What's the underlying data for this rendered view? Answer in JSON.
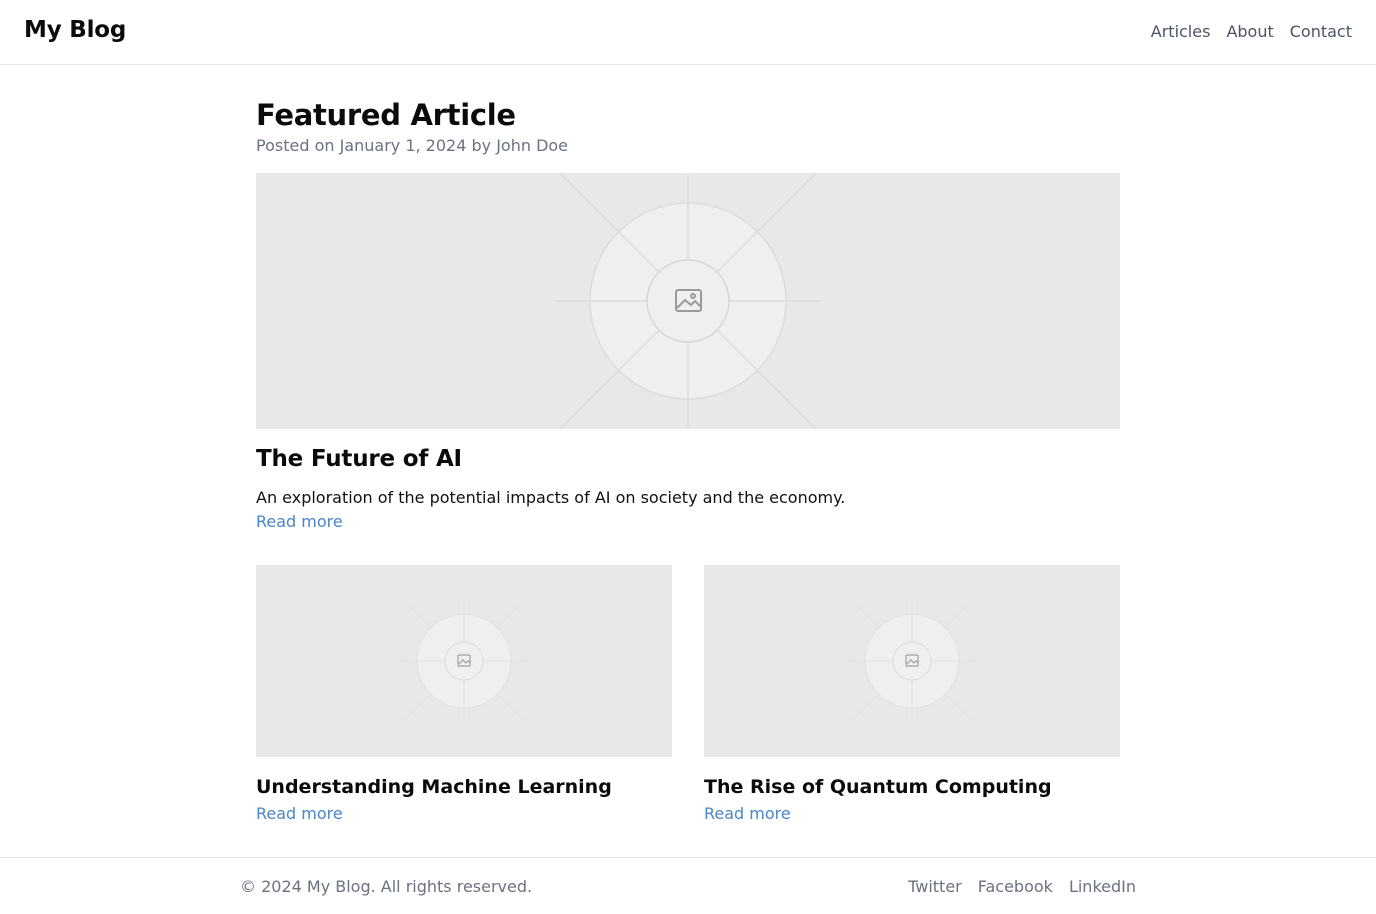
{
  "header": {
    "logo": "My Blog",
    "nav": [
      {
        "label": "Articles"
      },
      {
        "label": "About"
      },
      {
        "label": "Contact"
      }
    ]
  },
  "featured": {
    "heading": "Featured Article",
    "meta": "Posted on January 1, 2024 by John Doe",
    "image_icon": "image-placeholder-icon",
    "title": "The Future of AI",
    "excerpt": "An exploration of the potential impacts of AI on society and the economy.",
    "read_more": "Read more"
  },
  "articles": [
    {
      "title": "Understanding Machine Learning",
      "read_more": "Read more",
      "image_icon": "image-placeholder-icon"
    },
    {
      "title": "The Rise of Quantum Computing",
      "read_more": "Read more",
      "image_icon": "image-placeholder-icon"
    }
  ],
  "footer": {
    "copyright": "© 2024 My Blog. All rights reserved.",
    "links": [
      {
        "label": "Twitter"
      },
      {
        "label": "Facebook"
      },
      {
        "label": "LinkedIn"
      }
    ]
  },
  "colors": {
    "link": "#4a86c8",
    "muted_text": "#6b7280",
    "placeholder_bg": "#e8e8e8",
    "border": "#e5e5e5"
  }
}
